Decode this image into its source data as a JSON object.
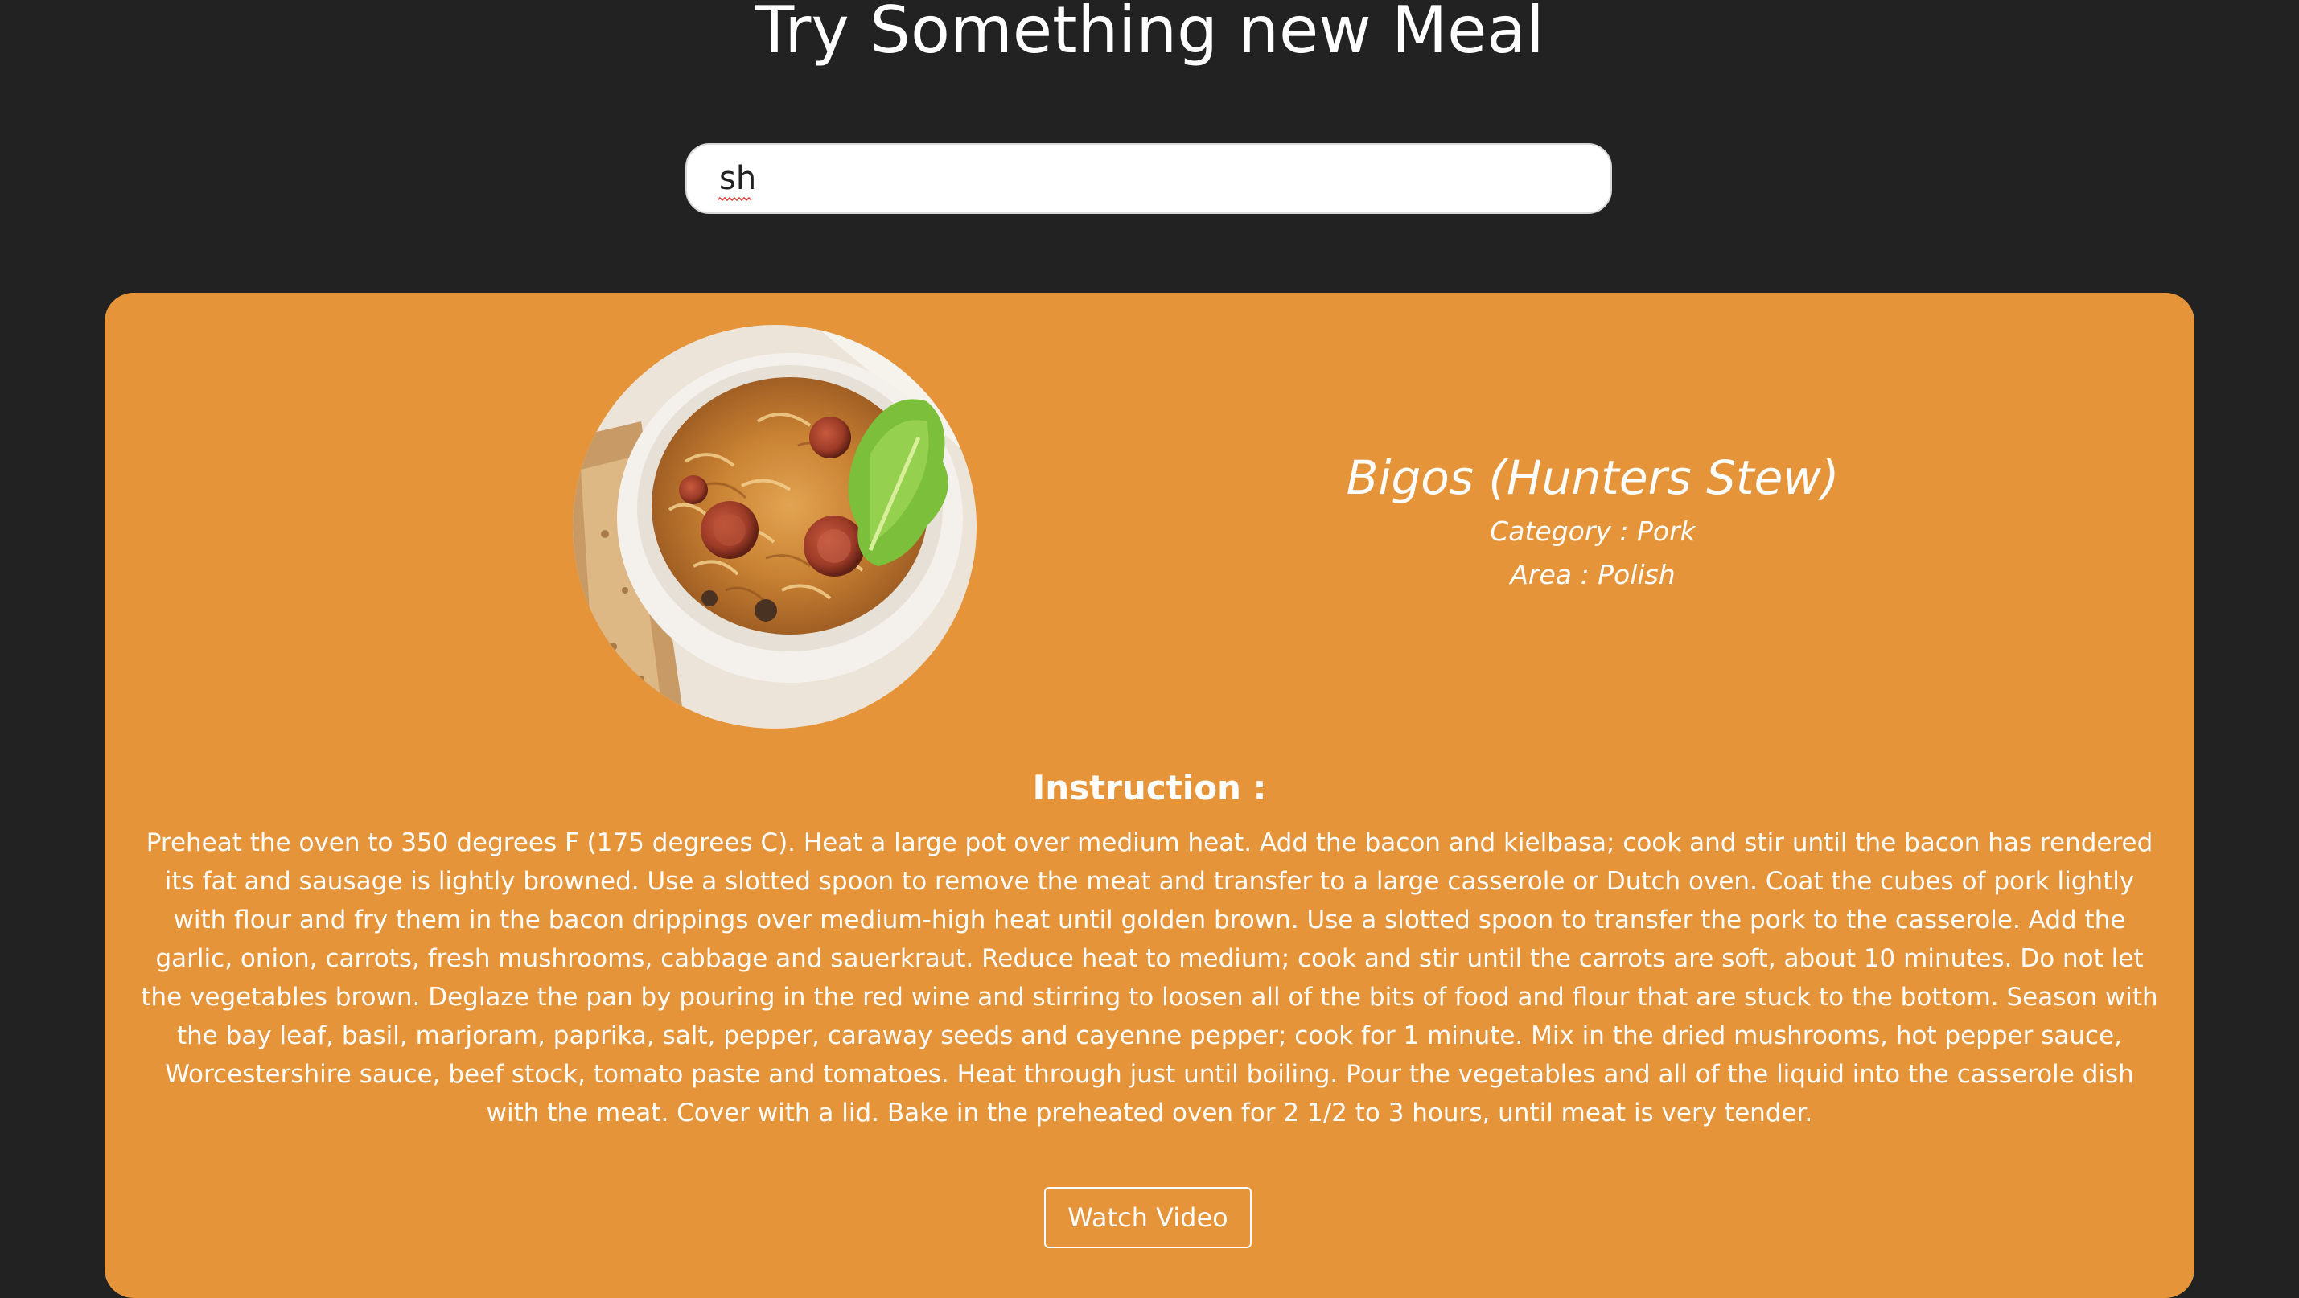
{
  "header": {
    "title": "Try Something new Meal"
  },
  "search": {
    "value": "sh",
    "placeholder": ""
  },
  "meal": {
    "name": "Bigos (Hunters Stew)",
    "category": "Category : Pork",
    "area": "Area : Polish",
    "image_alt": "Bigos (Hunters Stew)",
    "instruction_heading": "Instruction :",
    "instructions": "Preheat the oven to 350 degrees F (175 degrees C). Heat a large pot over medium heat. Add the bacon and kielbasa; cook and stir until the bacon has rendered its fat and sausage is lightly browned. Use a slotted spoon to remove the meat and transfer to a large casserole or Dutch oven. Coat the cubes of pork lightly with flour and fry them in the bacon drippings over medium-high heat until golden brown. Use a slotted spoon to transfer the pork to the casserole. Add the garlic, onion, carrots, fresh mushrooms, cabbage and sauerkraut. Reduce heat to medium; cook and stir until the carrots are soft, about 10 minutes. Do not let the vegetables brown. Deglaze the pan by pouring in the red wine and stirring to loosen all of the bits of food and flour that are stuck to the bottom. Season with the bay leaf, basil, marjoram, paprika, salt, pepper, caraway seeds and cayenne pepper; cook for 1 minute. Mix in the dried mushrooms, hot pepper sauce, Worcestershire sauce, beef stock, tomato paste and tomatoes. Heat through just until boiling. Pour the vegetables and all of the liquid into the casserole dish with the meat. Cover with a lid. Bake in the preheated oven for 2 1/2 to 3 hours, until meat is very tender.",
    "video_label": "Watch Video"
  },
  "colors": {
    "page_background": "#222222",
    "card_background": "#e5943a",
    "text": "#ffffff"
  }
}
